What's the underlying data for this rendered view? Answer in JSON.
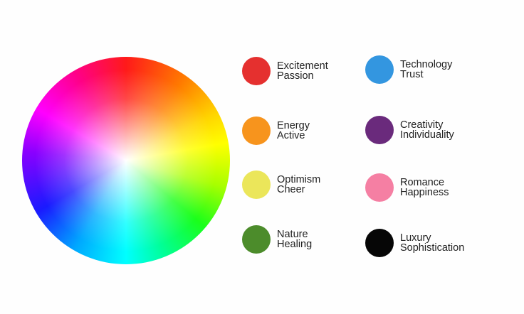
{
  "legend": [
    {
      "line1": "Excitement",
      "line2": "Passion",
      "color": "#e5302f"
    },
    {
      "line1": "Energy",
      "line2": "Active",
      "color": "#f7941d"
    },
    {
      "line1": "Optimism",
      "line2": "Cheer",
      "color": "#ebe65a"
    },
    {
      "line1": "Nature",
      "line2": "Healing",
      "color": "#4c8c2b"
    },
    {
      "line1": "Technology",
      "line2": "Trust",
      "color": "#3396e0"
    },
    {
      "line1": "Creativity",
      "line2": "Individuality",
      "color": "#6a2a7c"
    },
    {
      "line1": "Romance",
      "line2": "Happiness",
      "color": "#f57fa3"
    },
    {
      "line1": "Luxury",
      "line2": "Sophistication",
      "color": "#060606"
    }
  ]
}
